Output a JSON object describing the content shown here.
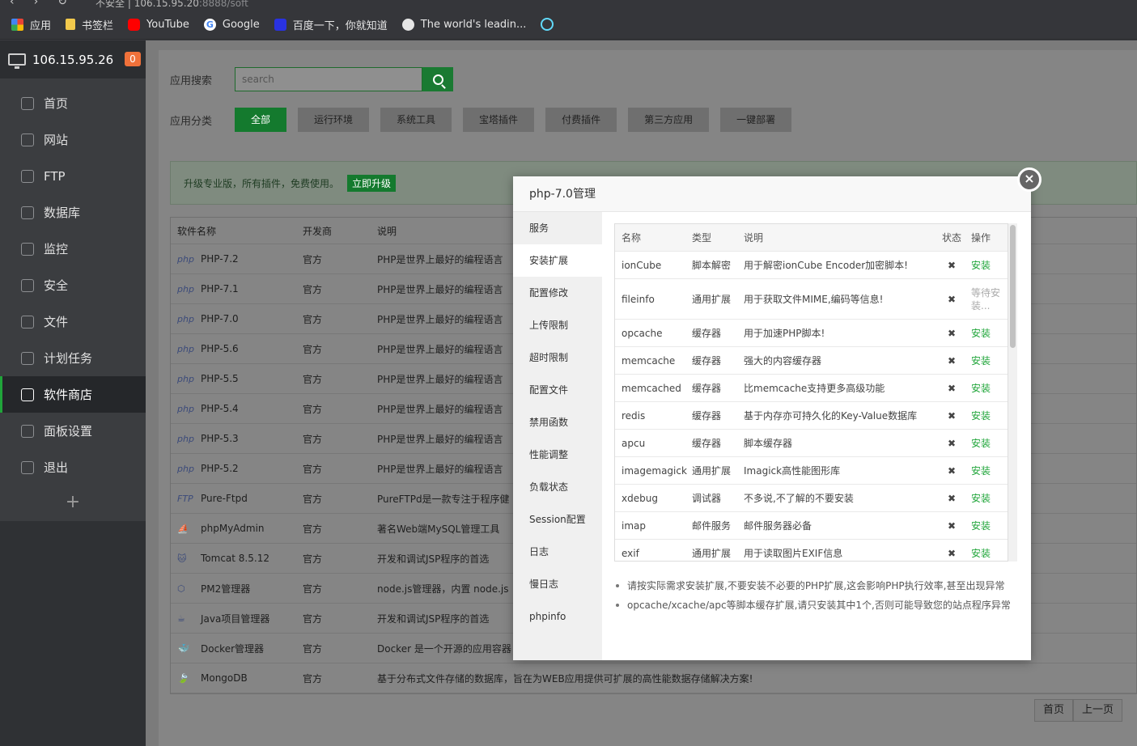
{
  "browser": {
    "url_host": "106.15.95.20",
    "url_path": ":8888/soft",
    "url_prefix": "不安全 |",
    "bookmarks": [
      "应用",
      "书签栏",
      "YouTube",
      "Google",
      "百度一下，你就知道",
      "The world's leadin..."
    ]
  },
  "sidebar": {
    "host": "106.15.95.26",
    "badge": "0",
    "items": [
      "首页",
      "网站",
      "FTP",
      "数据库",
      "监控",
      "安全",
      "文件",
      "计划任务",
      "软件商店",
      "面板设置",
      "退出"
    ],
    "active_index": 8,
    "add_symbol": "+"
  },
  "search": {
    "label": "应用搜索",
    "placeholder": "search"
  },
  "categories": {
    "label": "应用分类",
    "items": [
      "全部",
      "运行环境",
      "系统工具",
      "宝塔插件",
      "付费插件",
      "第三方应用",
      "一键部署"
    ]
  },
  "banner": {
    "text": "升级专业版，所有插件，免费使用。",
    "button": "立即升级"
  },
  "soft_table": {
    "headers": [
      "软件名称",
      "开发商",
      "说明"
    ],
    "rows": [
      {
        "icon": "php",
        "name": "PHP-7.2",
        "vendor": "官方",
        "desc": "PHP是世界上最好的编程语言"
      },
      {
        "icon": "php",
        "name": "PHP-7.1",
        "vendor": "官方",
        "desc": "PHP是世界上最好的编程语言"
      },
      {
        "icon": "php",
        "name": "PHP-7.0",
        "vendor": "官方",
        "desc": "PHP是世界上最好的编程语言"
      },
      {
        "icon": "php",
        "name": "PHP-5.6",
        "vendor": "官方",
        "desc": "PHP是世界上最好的编程语言"
      },
      {
        "icon": "php",
        "name": "PHP-5.5",
        "vendor": "官方",
        "desc": "PHP是世界上最好的编程语言"
      },
      {
        "icon": "php",
        "name": "PHP-5.4",
        "vendor": "官方",
        "desc": "PHP是世界上最好的编程语言"
      },
      {
        "icon": "php",
        "name": "PHP-5.3",
        "vendor": "官方",
        "desc": "PHP是世界上最好的编程语言"
      },
      {
        "icon": "php",
        "name": "PHP-5.2",
        "vendor": "官方",
        "desc": "PHP是世界上最好的编程语言"
      },
      {
        "icon": "FTP",
        "name": "Pure-Ftpd",
        "vendor": "官方",
        "desc": "PureFTPd是一款专注于程序健"
      },
      {
        "icon": "⛵",
        "name": "phpMyAdmin",
        "vendor": "官方",
        "desc": "著名Web端MySQL管理工具"
      },
      {
        "icon": "🐱",
        "name": "Tomcat 8.5.12",
        "vendor": "官方",
        "desc": "开发和调试JSP程序的首选"
      },
      {
        "icon": "⬡",
        "name": "PM2管理器",
        "vendor": "官方",
        "desc": "node.js管理器，内置 node.js"
      },
      {
        "icon": "☕",
        "name": "Java项目管理器",
        "vendor": "官方",
        "desc": "开发和调试JSP程序的首选"
      },
      {
        "icon": "🐳",
        "name": "Docker管理器",
        "vendor": "官方",
        "desc": "Docker 是一个开源的应用容器"
      },
      {
        "icon": "🍃",
        "name": "MongoDB",
        "vendor": "官方",
        "desc": "基于分布式文件存储的数据库，旨在为WEB应用提供可扩展的高性能数据存储解决方案!"
      }
    ]
  },
  "pager": [
    "首页",
    "上一页"
  ],
  "modal": {
    "title": "php-7.0管理",
    "close": "×",
    "tabs": [
      "服务",
      "安装扩展",
      "配置修改",
      "上传限制",
      "超时限制",
      "配置文件",
      "禁用函数",
      "性能调整",
      "负载状态",
      "Session配置",
      "日志",
      "慢日志",
      "phpinfo"
    ],
    "active_tab": 1,
    "ext_headers": [
      "名称",
      "类型",
      "说明",
      "状态",
      "操作"
    ],
    "extensions": [
      {
        "name": "ionCube",
        "type": "脚本解密",
        "desc": "用于解密ionCube Encoder加密脚本!",
        "status": "✖",
        "action": "安装"
      },
      {
        "name": "fileinfo",
        "type": "通用扩展",
        "desc": "用于获取文件MIME,编码等信息!",
        "status": "✖",
        "action": "等待安装..."
      },
      {
        "name": "opcache",
        "type": "缓存器",
        "desc": "用于加速PHP脚本!",
        "status": "✖",
        "action": "安装"
      },
      {
        "name": "memcache",
        "type": "缓存器",
        "desc": "强大的内容缓存器",
        "status": "✖",
        "action": "安装"
      },
      {
        "name": "memcached",
        "type": "缓存器",
        "desc": "比memcache支持更多高级功能",
        "status": "✖",
        "action": "安装"
      },
      {
        "name": "redis",
        "type": "缓存器",
        "desc": "基于内存亦可持久化的Key-Value数据库",
        "status": "✖",
        "action": "安装"
      },
      {
        "name": "apcu",
        "type": "缓存器",
        "desc": "脚本缓存器",
        "status": "✖",
        "action": "安装"
      },
      {
        "name": "imagemagick",
        "type": "通用扩展",
        "desc": "Imagick高性能图形库",
        "status": "✖",
        "action": "安装"
      },
      {
        "name": "xdebug",
        "type": "调试器",
        "desc": "不多说,不了解的不要安装",
        "status": "✖",
        "action": "安装"
      },
      {
        "name": "imap",
        "type": "邮件服务",
        "desc": "邮件服务器必备",
        "status": "✖",
        "action": "安装"
      },
      {
        "name": "exif",
        "type": "通用扩展",
        "desc": "用于读取图片EXIF信息",
        "status": "✖",
        "action": "安装"
      }
    ],
    "notes": [
      "请按实际需求安装扩展,不要安装不必要的PHP扩展,这会影响PHP执行效率,甚至出现异常",
      "opcache/xcache/apc等脚本缓存扩展,请只安装其中1个,否则可能导致您的站点程序异常"
    ]
  }
}
